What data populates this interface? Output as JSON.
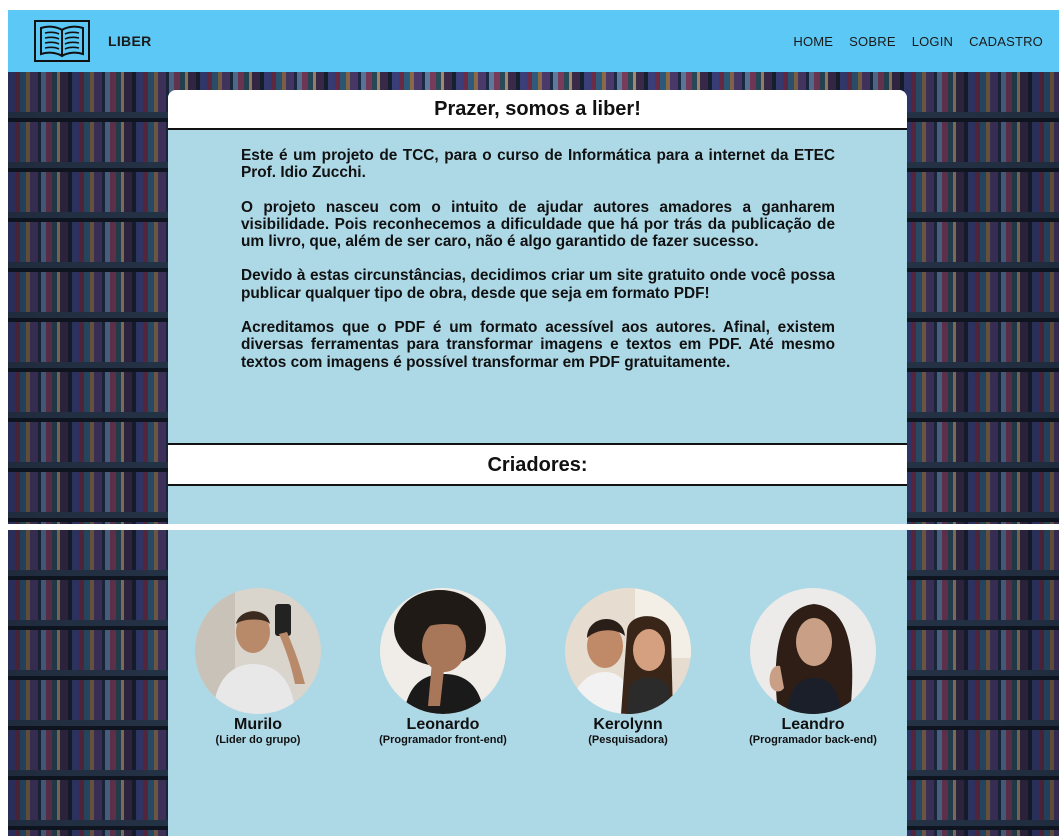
{
  "header": {
    "brand": "LIBER",
    "logo_icon": "open-book-icon",
    "nav": [
      "HOME",
      "SOBRE",
      "LOGIN",
      "CADASTRO"
    ],
    "bg_color": "#5bc8f5"
  },
  "about": {
    "title": "Prazer, somos a liber!",
    "paragraphs": [
      "Este é um projeto de TCC, para o curso de Informática para a internet da ETEC Prof. Idio Zucchi.",
      "O projeto nasceu com o intuito de ajudar autores amadores a ganharem visibilidade. Pois reconhecemos a dificuldade que há por trás da publicação de um livro, que, além de ser caro, não é algo garantido de fazer sucesso.",
      "Devido à estas circunstâncias, decidimos criar um site gratuito onde você possa publicar qualquer tipo de obra, desde que seja em formato PDF!",
      "Acreditamos que o PDF é um formato acessível aos autores. Afinal, existem diversas ferramentas para transformar imagens e textos em PDF. Até mesmo textos com imagens é possível transformar em PDF gratuitamente."
    ],
    "panel_color": "#add8e6"
  },
  "creators": {
    "title": "Criadores:",
    "people": [
      {
        "name": "Murilo",
        "role": "(Lider do grupo)"
      },
      {
        "name": "Leonardo",
        "role": "(Programador front-end)"
      },
      {
        "name": "Kerolynn",
        "role": "(Pesquisadora)"
      },
      {
        "name": "Leandro",
        "role": "(Programador back-end)"
      }
    ]
  }
}
